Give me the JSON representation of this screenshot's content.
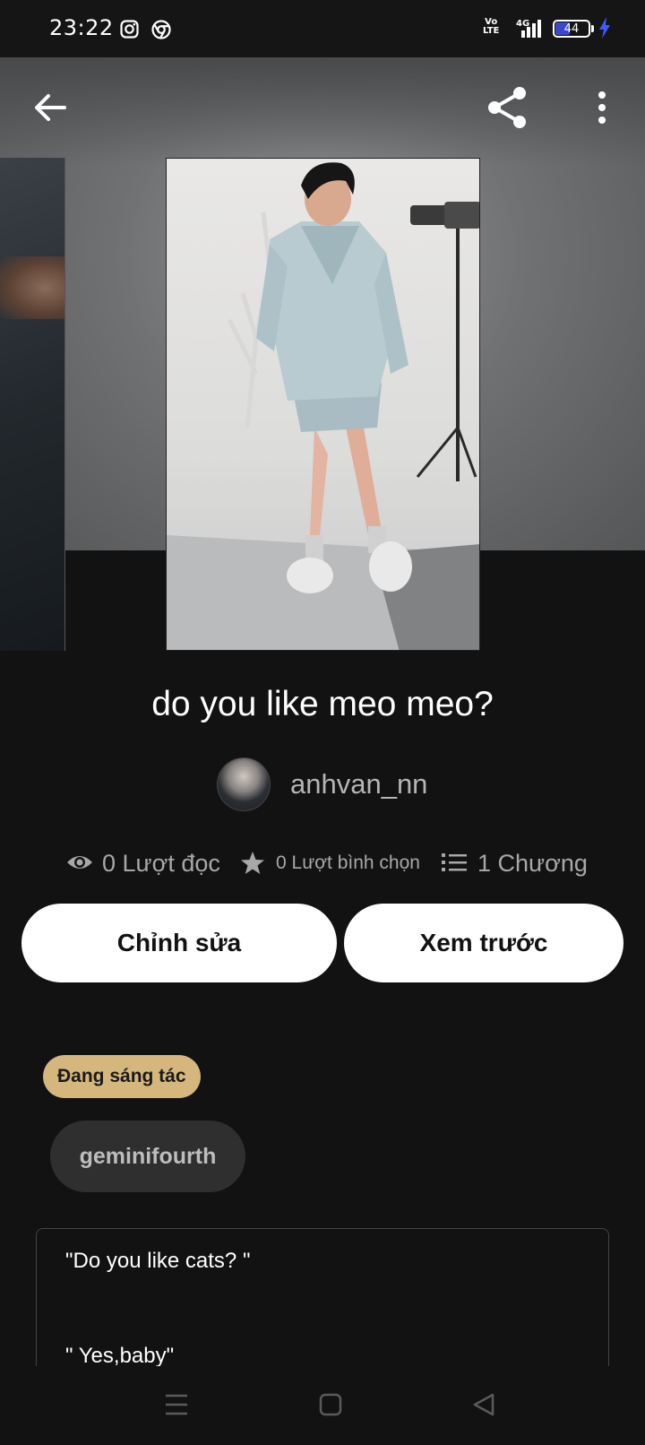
{
  "status_bar": {
    "time": "23:22",
    "network_volte": "Vo\nLTE",
    "network_type": "4G",
    "battery_level": "44",
    "battery_percent": 44,
    "battery_color": "#3b48c9",
    "charging_color": "#3b5bff"
  },
  "toolbar": {
    "back_icon": "arrow-left-icon",
    "share_icon": "share-icon",
    "more_icon": "more-vertical-icon"
  },
  "story": {
    "title": "do you like meo meo?",
    "author": "anhvan_nn",
    "stats": {
      "reads": "0 Lượt đọc",
      "votes": "0 Lượt bình chọn",
      "parts": "1 Chương"
    },
    "edit_label": "Chỉnh sửa",
    "preview_label": "Xem trước",
    "status_label": "Đang sáng tác",
    "status_color": "#d5b77e",
    "tag": "geminifourth",
    "description": {
      "line1": "\"Do you like cats? \"",
      "line2": "\" Yes,baby\""
    }
  },
  "nav": {
    "menu_icon": "menu-icon",
    "home_icon": "home-square-icon",
    "back_icon": "triangle-back-icon"
  }
}
